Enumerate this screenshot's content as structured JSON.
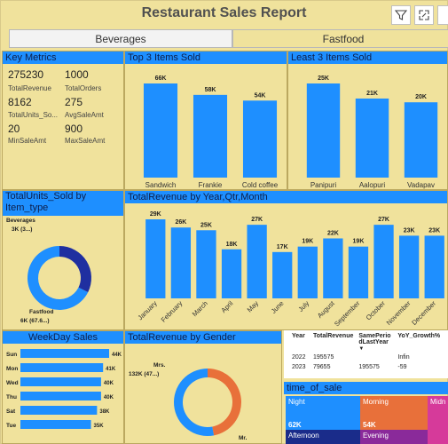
{
  "report": {
    "title": "Restaurant Sales Report",
    "toolbar": {
      "filter_icon": "filter-icon",
      "focus_icon": "expand-icon"
    }
  },
  "tabs": [
    {
      "label": "Beverages",
      "active": true
    },
    {
      "label": "Fastfood",
      "active": false
    }
  ],
  "key_metrics": {
    "title": "Key Metrics",
    "items": [
      {
        "value": "275230",
        "label": "TotalRevenue"
      },
      {
        "value": "1000",
        "label": "TotalOrders"
      },
      {
        "value": "8162",
        "label": "TotalUnits_So..."
      },
      {
        "value": "275",
        "label": "AvgSaleAmt"
      },
      {
        "value": "20",
        "label": "MinSaleAmt"
      },
      {
        "value": "900",
        "label": "MaxSaleAmt"
      }
    ]
  },
  "top3": {
    "title": "Top 3 Items Sold",
    "chart_data": {
      "type": "bar",
      "categories": [
        "Sandwich",
        "Frankie",
        "Cold coffee"
      ],
      "values": [
        66,
        58,
        54
      ],
      "labels": [
        "66K",
        "58K",
        "54K"
      ],
      "ylim": [
        0,
        66
      ]
    }
  },
  "least3": {
    "title": "Least 3 Items Sold",
    "chart_data": {
      "type": "bar",
      "categories": [
        "Panipuri",
        "Aalopuri",
        "Vadapav"
      ],
      "values": [
        25,
        21,
        20
      ],
      "labels": [
        "25K",
        "21K",
        "20K"
      ],
      "ylim": [
        0,
        25
      ]
    }
  },
  "units_by_type": {
    "title": "TotalUnits_Sold by Item_type",
    "chart_data": {
      "type": "pie",
      "categories": [
        "Beverages",
        "Fastfood"
      ],
      "values": [
        32.4,
        67.6
      ],
      "labels": [
        "3K (3...)",
        "6K (67.6...)"
      ],
      "colors": [
        "#1f2fa0",
        "#1e8fff"
      ]
    }
  },
  "revenue_month": {
    "title": "TotalRevenue by Year,Qtr,Month",
    "chart_data": {
      "type": "bar",
      "categories": [
        "January",
        "February",
        "March",
        "April",
        "May",
        "June",
        "July",
        "August",
        "September",
        "October",
        "November",
        "December"
      ],
      "values": [
        29,
        26,
        25,
        18,
        27,
        17,
        19,
        22,
        19,
        27,
        23,
        23
      ],
      "labels": [
        "29K",
        "26K",
        "25K",
        "18K",
        "27K",
        "17K",
        "19K",
        "22K",
        "19K",
        "27K",
        "23K",
        "23K"
      ],
      "ylim": [
        0,
        29
      ]
    }
  },
  "weekday": {
    "title": "WeekDay Sales",
    "chart_data": {
      "type": "bar",
      "orientation": "horizontal",
      "categories": [
        "Sun",
        "Mon",
        "Wed",
        "Thu",
        "Sat",
        "Tue"
      ],
      "values": [
        44,
        41,
        40,
        40,
        38,
        35
      ],
      "labels": [
        "44K",
        "41K",
        "40K",
        "40K",
        "38K",
        "35K"
      ],
      "ylim": [
        0,
        44
      ]
    }
  },
  "gender": {
    "title": "TotalRevenue by Gender",
    "chart_data": {
      "type": "pie",
      "categories": [
        "Mrs.",
        "Mr."
      ],
      "values": [
        47,
        53
      ],
      "labels": [
        "132K (47...)",
        ""
      ],
      "colors": [
        "#e8703a",
        "#1e8fff"
      ]
    }
  },
  "yoy_table": {
    "headers": [
      "Year",
      "TotalRevenue",
      "SamePeriodLastYear",
      "YoY_Growth%"
    ],
    "sort_icon": "sort-desc-icon",
    "rows": [
      [
        "2022",
        "195575",
        "",
        "Infin"
      ],
      [
        "2023",
        "79655",
        "195575",
        "-59"
      ]
    ]
  },
  "time_of_sale": {
    "title": "time_of_sale",
    "cells": [
      {
        "label": "Night",
        "value": "62K",
        "color": "#1e8fff"
      },
      {
        "label": "Morning",
        "value": "54K",
        "color": "#e8703a"
      },
      {
        "label": "Midn",
        "value": "",
        "color": "#d63a9a"
      },
      {
        "label": "Afternoon",
        "value": "",
        "color": "#1a2c8a"
      },
      {
        "label": "Evening",
        "value": "",
        "color": "#8a2a9a"
      }
    ]
  }
}
